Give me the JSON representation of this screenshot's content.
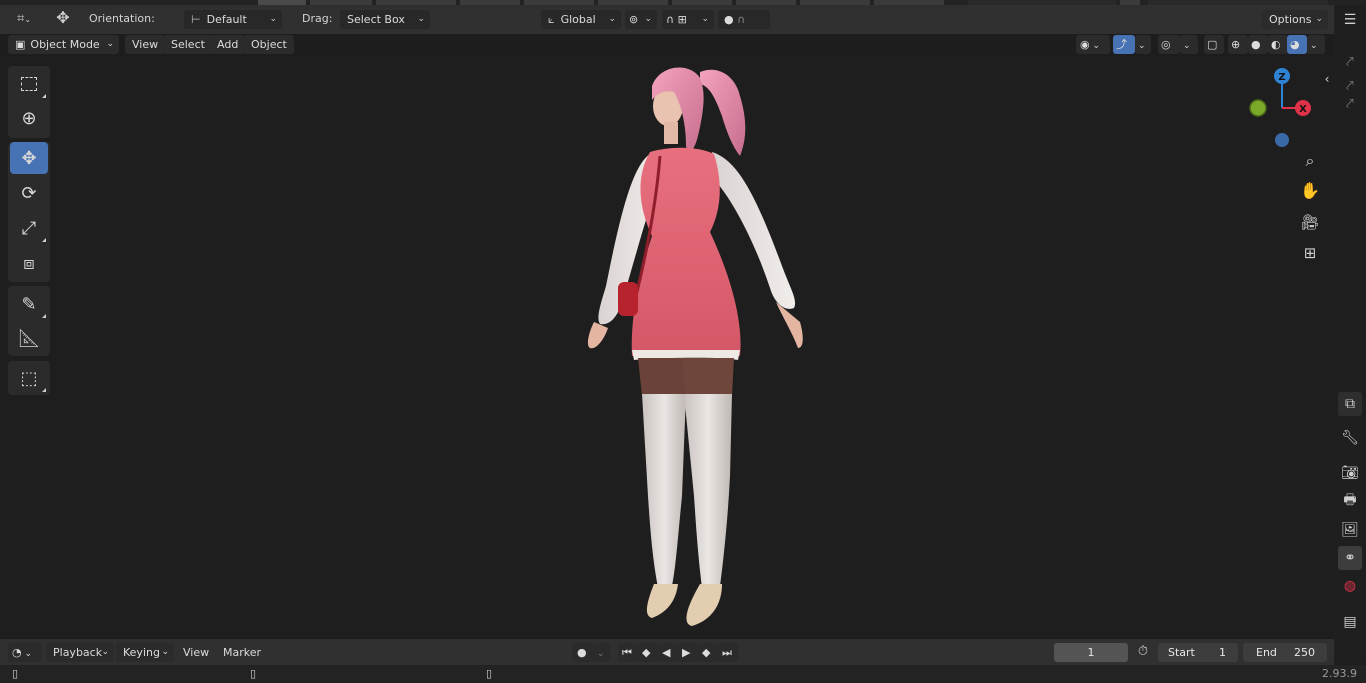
{
  "header": {
    "orientation_label": "Orientation:",
    "orientation_value": "Default",
    "drag_label": "Drag:",
    "drag_value": "Select Box",
    "transform_space": "Global",
    "options_label": "Options"
  },
  "view_header": {
    "mode": "Object Mode",
    "menus": [
      "View",
      "Select",
      "Add",
      "Object"
    ]
  },
  "gizmo": {
    "z": "Z",
    "x": "X"
  },
  "timeline": {
    "menus": [
      "Playback",
      "Keying",
      "View",
      "Marker"
    ],
    "current_frame": "1",
    "start_label": "Start",
    "start_value": "1",
    "end_label": "End",
    "end_value": "250"
  },
  "status": {
    "version": "2.93.9"
  },
  "colors": {
    "accent": "#4772b3",
    "axis_x": "#e0334a",
    "axis_y": "#7aa92a",
    "axis_z": "#2f83d4"
  },
  "icons": {
    "toolbar": [
      "select-box-icon",
      "cursor-icon",
      "move-icon",
      "rotate-icon",
      "scale-icon",
      "transform-icon",
      "annotate-icon",
      "measure-icon",
      "add-cube-icon"
    ],
    "navigation": [
      "zoom-icon",
      "hand-icon",
      "camera-icon",
      "grid-icon"
    ]
  }
}
